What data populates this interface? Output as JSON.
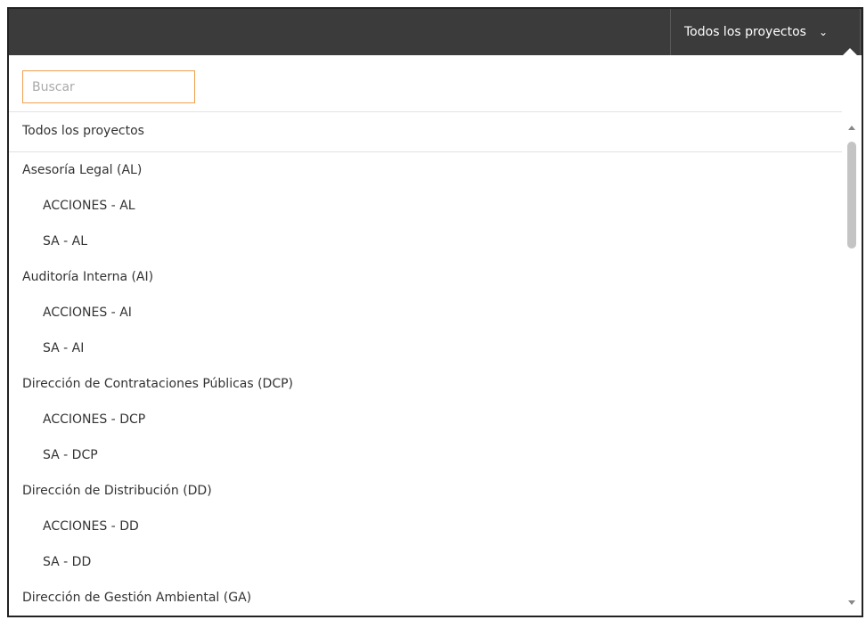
{
  "header": {
    "project_selector_label": "Todos los proyectos",
    "chevron_icon": "chevron-down-icon"
  },
  "search": {
    "placeholder": "Buscar",
    "value": ""
  },
  "list": {
    "all_label": "Todos los proyectos",
    "items": [
      {
        "label": "Asesoría Legal (AL)",
        "level": 0
      },
      {
        "label": "ACCIONES - AL",
        "level": 1
      },
      {
        "label": "SA - AL",
        "level": 1
      },
      {
        "label": "Auditoría Interna (AI)",
        "level": 0
      },
      {
        "label": "ACCIONES - AI",
        "level": 1
      },
      {
        "label": "SA - AI",
        "level": 1
      },
      {
        "label": "Dirección de Contrataciones Públicas (DCP)",
        "level": 0
      },
      {
        "label": "ACCIONES - DCP",
        "level": 1
      },
      {
        "label": "SA - DCP",
        "level": 1
      },
      {
        "label": "Dirección de Distribución (DD)",
        "level": 0
      },
      {
        "label": "ACCIONES - DD",
        "level": 1
      },
      {
        "label": "SA - DD",
        "level": 1
      },
      {
        "label": "Dirección de Gestión Ambiental (GA)",
        "level": 0
      }
    ]
  },
  "colors": {
    "topbar": "#3b3b3b",
    "search_border": "#f0a050"
  }
}
